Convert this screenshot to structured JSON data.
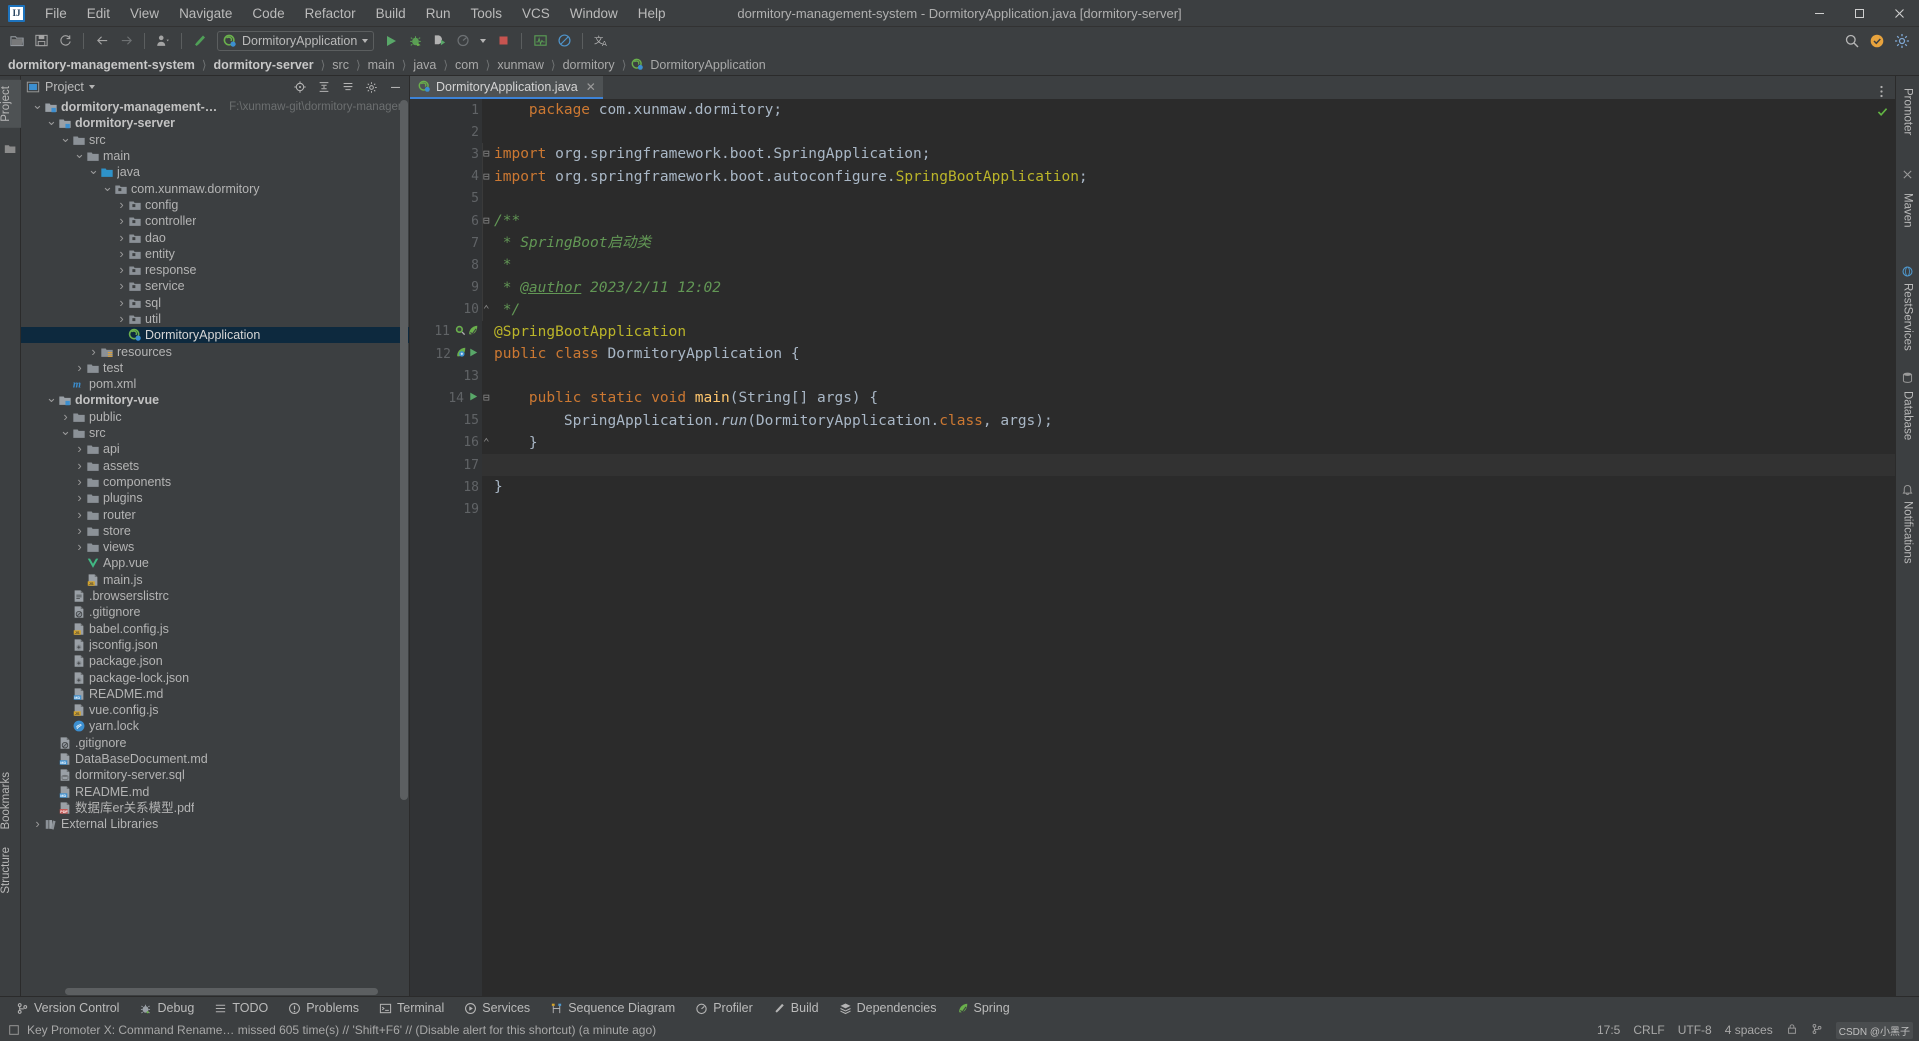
{
  "window": {
    "title": "dormitory-management-system - DormitoryApplication.java [dormitory-server]",
    "logo_text": "IJ",
    "minimize": "—",
    "maximize": "❐",
    "close": "✕"
  },
  "menu": [
    {
      "label": "File"
    },
    {
      "label": "Edit"
    },
    {
      "label": "View"
    },
    {
      "label": "Navigate"
    },
    {
      "label": "Code"
    },
    {
      "label": "Refactor"
    },
    {
      "label": "Build"
    },
    {
      "label": "Run"
    },
    {
      "label": "Tools"
    },
    {
      "label": "VCS"
    },
    {
      "label": "Window"
    },
    {
      "label": "Help"
    }
  ],
  "toolbar": {
    "open_icon": "folder-open-icon",
    "save_icon": "save-icon",
    "sync_icon": "refresh-icon",
    "back_icon": "arrow-left-icon",
    "forward_icon": "arrow-right-icon",
    "profile_icon": "user-icon",
    "build_icon": "hammer-icon",
    "run_config": "DormitoryApplication",
    "run_icon": "run-triangle-icon",
    "debug_icon": "debug-bug-icon",
    "run_coverage_icon": "run-with-coverage-icon",
    "profile_run_icon": "profiler-icon",
    "stop_icon": "stop-square-icon",
    "monitor_icon": "activity-monitor-icon",
    "forbidden_icon": "no-entry-icon",
    "translate_icon": "translate-icon",
    "search_icon": "search-everywhere-icon",
    "settings_icon": "gear-icon",
    "updates_icon": "update-badge-icon"
  },
  "breadcrumb": [
    {
      "label": "dormitory-management-system",
      "bold": true
    },
    {
      "label": "dormitory-server",
      "bold": true
    },
    {
      "label": "src",
      "bold": false
    },
    {
      "label": "main",
      "bold": false
    },
    {
      "label": "java",
      "bold": false
    },
    {
      "label": "com",
      "bold": false
    },
    {
      "label": "xunmaw",
      "bold": false
    },
    {
      "label": "dormitory",
      "bold": false
    },
    {
      "label": "DormitoryApplication",
      "bold": false,
      "icon": "spring-class-icon"
    }
  ],
  "left_strip": {
    "project_tab": "Project",
    "bookmarks_tab": "Bookmarks",
    "structure_tab": "Structure",
    "folder_icon": "folder-icon"
  },
  "right_strip": {
    "notifications_tab": "Notifications",
    "database_tab": "Database",
    "maven_tab": "Maven",
    "promoter_tab": "Promoter",
    "rest_services_tab": "RestServices"
  },
  "project_panel": {
    "title": "Project",
    "view_icon": "project-view-icon",
    "dropdown_icon": "chevron-down-icon",
    "locate_icon": "scroll-from-source-icon",
    "collapse_icon": "collapse-all-icon",
    "expand_icon": "expand-all-icon",
    "settings_icon": "gear-icon",
    "hide_icon": "hide-icon",
    "tree": [
      {
        "depth": 0,
        "arrow": "down",
        "icon": "module-icon",
        "label": "dormitory-management-system",
        "bold": true,
        "sub": "F:\\xunmaw-git\\dormitory-management-s"
      },
      {
        "depth": 1,
        "arrow": "down",
        "icon": "module-icon",
        "label": "dormitory-server",
        "bold": true,
        "sub": ""
      },
      {
        "depth": 2,
        "arrow": "down",
        "icon": "folder-icon",
        "label": "src",
        "bold": false,
        "sub": ""
      },
      {
        "depth": 3,
        "arrow": "down",
        "icon": "folder-icon",
        "label": "main",
        "bold": false,
        "sub": ""
      },
      {
        "depth": 4,
        "arrow": "down",
        "icon": "source-folder-icon",
        "label": "java",
        "bold": false,
        "sub": ""
      },
      {
        "depth": 5,
        "arrow": "down",
        "icon": "package-icon",
        "label": "com.xunmaw.dormitory",
        "bold": false,
        "sub": ""
      },
      {
        "depth": 6,
        "arrow": "right",
        "icon": "package-icon",
        "label": "config",
        "bold": false,
        "sub": ""
      },
      {
        "depth": 6,
        "arrow": "right",
        "icon": "package-icon",
        "label": "controller",
        "bold": false,
        "sub": ""
      },
      {
        "depth": 6,
        "arrow": "right",
        "icon": "package-icon",
        "label": "dao",
        "bold": false,
        "sub": ""
      },
      {
        "depth": 6,
        "arrow": "right",
        "icon": "package-icon",
        "label": "entity",
        "bold": false,
        "sub": ""
      },
      {
        "depth": 6,
        "arrow": "right",
        "icon": "package-icon",
        "label": "response",
        "bold": false,
        "sub": ""
      },
      {
        "depth": 6,
        "arrow": "right",
        "icon": "package-icon",
        "label": "service",
        "bold": false,
        "sub": ""
      },
      {
        "depth": 6,
        "arrow": "right",
        "icon": "package-icon",
        "label": "sql",
        "bold": false,
        "sub": ""
      },
      {
        "depth": 6,
        "arrow": "right",
        "icon": "package-icon",
        "label": "util",
        "bold": false,
        "sub": ""
      },
      {
        "depth": 6,
        "arrow": "none",
        "icon": "spring-class-icon",
        "label": "DormitoryApplication",
        "bold": false,
        "sub": "",
        "selected": true
      },
      {
        "depth": 4,
        "arrow": "right",
        "icon": "resource-folder-icon",
        "label": "resources",
        "bold": false,
        "sub": ""
      },
      {
        "depth": 3,
        "arrow": "right",
        "icon": "folder-icon",
        "label": "test",
        "bold": false,
        "sub": ""
      },
      {
        "depth": 2,
        "arrow": "none",
        "icon": "maven-icon",
        "label": "pom.xml",
        "bold": false,
        "sub": ""
      },
      {
        "depth": 1,
        "arrow": "down",
        "icon": "module-icon",
        "label": "dormitory-vue",
        "bold": true,
        "sub": ""
      },
      {
        "depth": 2,
        "arrow": "right",
        "icon": "folder-icon",
        "label": "public",
        "bold": false,
        "sub": ""
      },
      {
        "depth": 2,
        "arrow": "down",
        "icon": "folder-icon",
        "label": "src",
        "bold": false,
        "sub": ""
      },
      {
        "depth": 3,
        "arrow": "right",
        "icon": "folder-icon",
        "label": "api",
        "bold": false,
        "sub": ""
      },
      {
        "depth": 3,
        "arrow": "right",
        "icon": "folder-icon",
        "label": "assets",
        "bold": false,
        "sub": ""
      },
      {
        "depth": 3,
        "arrow": "right",
        "icon": "folder-icon",
        "label": "components",
        "bold": false,
        "sub": ""
      },
      {
        "depth": 3,
        "arrow": "right",
        "icon": "folder-icon",
        "label": "plugins",
        "bold": false,
        "sub": ""
      },
      {
        "depth": 3,
        "arrow": "right",
        "icon": "folder-icon",
        "label": "router",
        "bold": false,
        "sub": ""
      },
      {
        "depth": 3,
        "arrow": "right",
        "icon": "folder-icon",
        "label": "store",
        "bold": false,
        "sub": ""
      },
      {
        "depth": 3,
        "arrow": "right",
        "icon": "folder-icon",
        "label": "views",
        "bold": false,
        "sub": ""
      },
      {
        "depth": 3,
        "arrow": "none",
        "icon": "vue-icon",
        "label": "App.vue",
        "bold": false,
        "sub": ""
      },
      {
        "depth": 3,
        "arrow": "none",
        "icon": "js-icon",
        "label": "main.js",
        "bold": false,
        "sub": ""
      },
      {
        "depth": 2,
        "arrow": "none",
        "icon": "text-file-icon",
        "label": ".browserslistrc",
        "bold": false,
        "sub": ""
      },
      {
        "depth": 2,
        "arrow": "none",
        "icon": "gitignore-icon",
        "label": ".gitignore",
        "bold": false,
        "sub": ""
      },
      {
        "depth": 2,
        "arrow": "none",
        "icon": "js-icon",
        "label": "babel.config.js",
        "bold": false,
        "sub": ""
      },
      {
        "depth": 2,
        "arrow": "none",
        "icon": "json-icon",
        "label": "jsconfig.json",
        "bold": false,
        "sub": ""
      },
      {
        "depth": 2,
        "arrow": "none",
        "icon": "json-icon",
        "label": "package.json",
        "bold": false,
        "sub": ""
      },
      {
        "depth": 2,
        "arrow": "none",
        "icon": "json-icon",
        "label": "package-lock.json",
        "bold": false,
        "sub": ""
      },
      {
        "depth": 2,
        "arrow": "none",
        "icon": "markdown-icon",
        "label": "README.md",
        "bold": false,
        "sub": ""
      },
      {
        "depth": 2,
        "arrow": "none",
        "icon": "js-icon",
        "label": "vue.config.js",
        "bold": false,
        "sub": ""
      },
      {
        "depth": 2,
        "arrow": "none",
        "icon": "yarn-icon",
        "label": "yarn.lock",
        "bold": false,
        "sub": ""
      },
      {
        "depth": 1,
        "arrow": "none",
        "icon": "gitignore-icon",
        "label": ".gitignore",
        "bold": false,
        "sub": ""
      },
      {
        "depth": 1,
        "arrow": "none",
        "icon": "markdown-icon",
        "label": "DataBaseDocument.md",
        "bold": false,
        "sub": ""
      },
      {
        "depth": 1,
        "arrow": "none",
        "icon": "sql-icon",
        "label": "dormitory-server.sql",
        "bold": false,
        "sub": ""
      },
      {
        "depth": 1,
        "arrow": "none",
        "icon": "markdown-icon",
        "label": "README.md",
        "bold": false,
        "sub": ""
      },
      {
        "depth": 1,
        "arrow": "none",
        "icon": "pdf-icon",
        "label": "数据库er关系模型.pdf",
        "bold": false,
        "sub": ""
      },
      {
        "depth": 0,
        "arrow": "right",
        "icon": "library-icon",
        "label": "External Libraries",
        "bold": false,
        "sub": ""
      }
    ]
  },
  "editor": {
    "tab": {
      "label": "DormitoryApplication.java",
      "icon": "spring-class-icon",
      "close_icon": "close-icon"
    },
    "options_icon": "more-options-icon",
    "inspection_ok_icon": "inspection-checkmark-icon",
    "lines": [
      {
        "n": 1,
        "marks": [],
        "fold": "",
        "html": "    <span class=\"kw\">package</span> com.xunmaw.dormitory;"
      },
      {
        "n": 2,
        "marks": [],
        "fold": "",
        "html": ""
      },
      {
        "n": 3,
        "marks": [],
        "fold": "minus",
        "html": "<span class=\"kw\">import</span> org.springframework.boot.SpringApplication;"
      },
      {
        "n": 4,
        "marks": [],
        "fold": "minus2",
        "html": "<span class=\"kw\">import</span> org.springframework.boot.autoconfigure.<span class=\"an\">SpringBootApplication</span>;"
      },
      {
        "n": 5,
        "marks": [],
        "fold": "",
        "html": ""
      },
      {
        "n": 6,
        "marks": [],
        "fold": "minus",
        "html": "<span class=\"cm\">/**</span>"
      },
      {
        "n": 7,
        "marks": [],
        "fold": "",
        "html": " <span class=\"cm\">* SpringBoot启动类</span>"
      },
      {
        "n": 8,
        "marks": [],
        "fold": "",
        "html": " <span class=\"cm\">*</span>"
      },
      {
        "n": 9,
        "marks": [],
        "fold": "",
        "html": " <span class=\"cm\">* </span><span class=\"cmt\">@author</span><span class=\"cm\"> 2023/2/11 12:02</span>"
      },
      {
        "n": 10,
        "marks": [],
        "fold": "end",
        "html": " <span class=\"cm\">*/</span>"
      },
      {
        "n": 11,
        "marks": [
          "bean-icon",
          "spring-leaf-icon"
        ],
        "fold": "",
        "html": "<span class=\"an\">@SpringBootApplication</span>"
      },
      {
        "n": 12,
        "marks": [
          "spring-bean-icon",
          "run-triangle-icon"
        ],
        "fold": "",
        "html": "<span class=\"kw\">public class</span> <span class=\"cls\">DormitoryApplication</span> {"
      },
      {
        "n": 13,
        "marks": [],
        "fold": "",
        "html": ""
      },
      {
        "n": 14,
        "marks": [
          "run-triangle-icon"
        ],
        "fold": "minus3",
        "html": "    <span class=\"kw\">public static void</span> <span class=\"mth\">main</span>(String[] args) {"
      },
      {
        "n": 15,
        "marks": [],
        "fold": "",
        "html": "        SpringApplication.<span class=\"itc\">run</span>(DormitoryApplication.<span class=\"kw\">class</span>, args);"
      },
      {
        "n": 16,
        "marks": [],
        "fold": "end3",
        "html": "    }"
      },
      {
        "n": 17,
        "marks": [],
        "fold": "",
        "html": "",
        "cursor": true
      },
      {
        "n": 18,
        "marks": [],
        "fold": "",
        "html": "}"
      },
      {
        "n": 19,
        "marks": [],
        "fold": "",
        "html": ""
      }
    ]
  },
  "tool_windows": [
    {
      "label": "Version Control",
      "icon": "branch-icon"
    },
    {
      "label": "Debug",
      "icon": "debug-bug-icon"
    },
    {
      "label": "TODO",
      "icon": "list-icon"
    },
    {
      "label": "Problems",
      "icon": "problems-icon"
    },
    {
      "label": "Terminal",
      "icon": "terminal-icon"
    },
    {
      "label": "Services",
      "icon": "services-play-icon"
    },
    {
      "label": "Sequence Diagram",
      "icon": "sequence-diagram-icon"
    },
    {
      "label": "Profiler",
      "icon": "profiler-icon"
    },
    {
      "label": "Build",
      "icon": "hammer-icon"
    },
    {
      "label": "Dependencies",
      "icon": "dependencies-icon"
    },
    {
      "label": "Spring",
      "icon": "spring-leaf-icon"
    }
  ],
  "status_bar": {
    "icon": "memory-indicator-icon",
    "message": "Key Promoter X: Command Rename… missed 605 time(s) // 'Shift+F6' // (Disable alert for this shortcut) (a minute ago)",
    "caret": "17:5",
    "line_sep": "CRLF",
    "encoding": "UTF-8",
    "indent": "4 spaces",
    "lock_icon": "lock-icon",
    "git_icon": "git-branch-icon",
    "watermark": "CSDN @小黑子"
  },
  "colors": {
    "bg_panel": "#3c3f41",
    "bg_editor": "#2b2b2b",
    "bg_gutter": "#313335",
    "accent_blue": "#3d83d7",
    "selection": "#0d293e",
    "keyword": "#cc7832",
    "annotation": "#bbb529",
    "comment": "#629755",
    "method": "#ffc66d",
    "text": "#a9b7c6",
    "green_run": "#59a869"
  }
}
